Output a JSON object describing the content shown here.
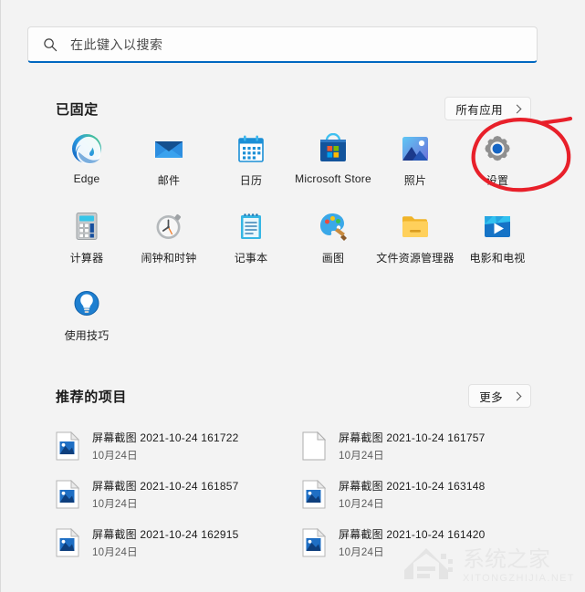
{
  "search": {
    "placeholder": "在此键入以搜索",
    "icon": "search-icon"
  },
  "pinned": {
    "title": "已固定",
    "all_apps_label": "所有应用",
    "apps": [
      {
        "label": "Edge",
        "icon": "edge-icon"
      },
      {
        "label": "邮件",
        "icon": "mail-icon"
      },
      {
        "label": "日历",
        "icon": "calendar-icon"
      },
      {
        "label": "Microsoft Store",
        "icon": "microsoft-store-icon"
      },
      {
        "label": "照片",
        "icon": "photos-icon"
      },
      {
        "label": "设置",
        "icon": "settings-gear-icon"
      },
      {
        "label": "计算器",
        "icon": "calculator-icon"
      },
      {
        "label": "闹钟和时钟",
        "icon": "alarms-clock-icon"
      },
      {
        "label": "记事本",
        "icon": "notepad-icon"
      },
      {
        "label": "画图",
        "icon": "paint-icon"
      },
      {
        "label": "文件资源管理器",
        "icon": "file-explorer-icon"
      },
      {
        "label": "电影和电视",
        "icon": "movies-tv-icon"
      },
      {
        "label": "使用技巧",
        "icon": "tips-bulb-icon"
      }
    ]
  },
  "recommended": {
    "title": "推荐的项目",
    "more_label": "更多",
    "items": [
      {
        "name": "屏幕截图 2021-10-24 161722",
        "date": "10月24日",
        "icon": "image-file-icon"
      },
      {
        "name": "屏幕截图 2021-10-24 161757",
        "date": "10月24日",
        "icon": "blank-file-icon"
      },
      {
        "name": "屏幕截图 2021-10-24 161857",
        "date": "10月24日",
        "icon": "image-file-icon"
      },
      {
        "name": "屏幕截图 2021-10-24 163148",
        "date": "10月24日",
        "icon": "image-file-icon"
      },
      {
        "name": "屏幕截图 2021-10-24 162915",
        "date": "10月24日",
        "icon": "image-file-icon"
      },
      {
        "name": "屏幕截图 2021-10-24 161420",
        "date": "10月24日",
        "icon": "image-file-icon"
      }
    ]
  },
  "annotation": {
    "shape": "red-ellipse-highlight",
    "target": "设置",
    "color": "#e8202a"
  },
  "watermark": {
    "text_cn": "系统之家",
    "text_url": "XITONGZHIJIA.NET"
  },
  "colors": {
    "panel_bg": "#f3f3f3",
    "accent": "#0067c0",
    "annotation_red": "#e8202a"
  }
}
